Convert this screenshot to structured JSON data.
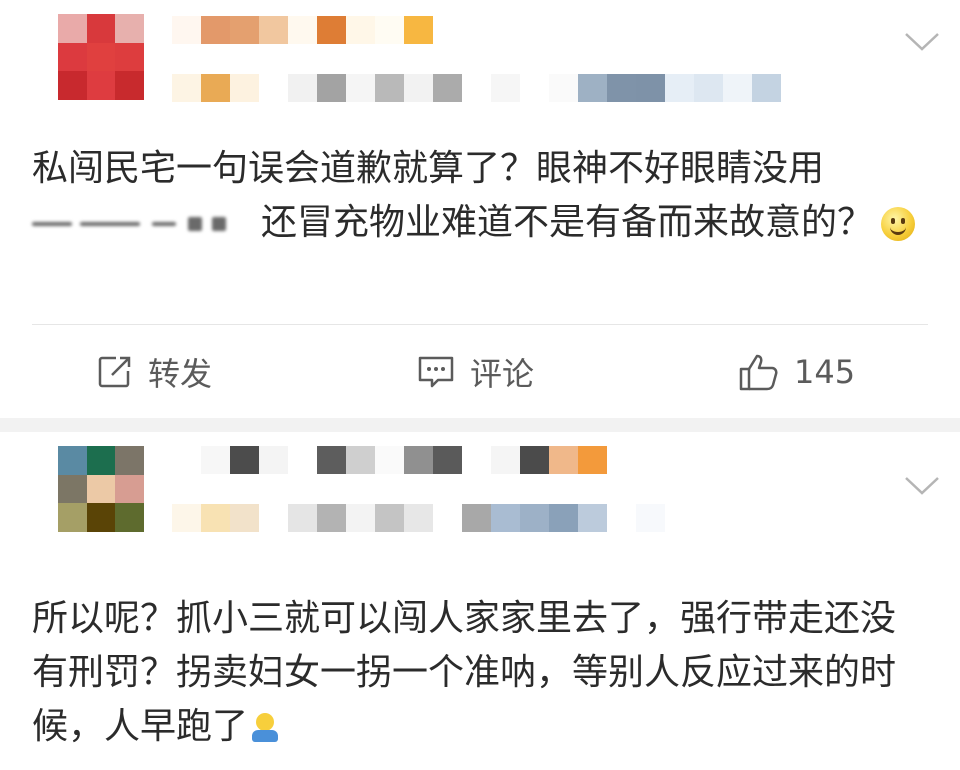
{
  "posts": [
    {
      "text_before": "私闯民宅一句误会道歉就算了？眼神不好眼睛没用",
      "text_after": "还冒充物业难道不是有备而来故意的？",
      "emoji": "smile-emoji",
      "actions": {
        "repost": "转发",
        "comment": "评论",
        "like_count": "145"
      }
    },
    {
      "text": "所以呢？抓小三就可以闯人家家里去了，强行带走还没有刑罚？拐卖妇女一拐一个准呐，等别人反应过来的时候，人早跑了",
      "emoji": "shrug-emoji"
    }
  ],
  "icons": {
    "more": "chevron-down-icon",
    "repost": "repost-icon",
    "comment": "comment-icon",
    "like": "thumbs-up-icon"
  },
  "colors": {
    "text": "#2b2b2b",
    "action": "#5b5b5b",
    "separator": "#f2f2f2",
    "divider": "#e6e6e6"
  }
}
